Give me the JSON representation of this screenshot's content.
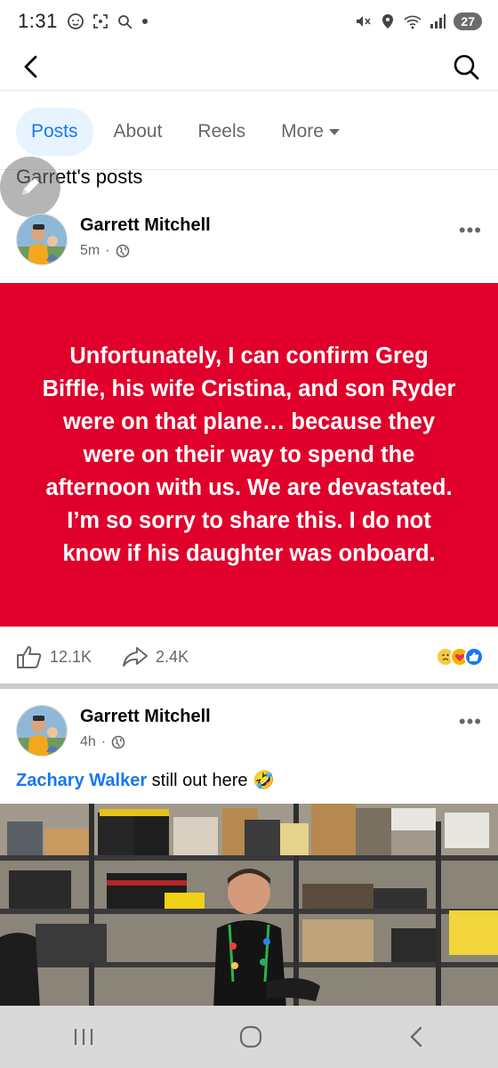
{
  "status_bar": {
    "time": "1:31",
    "battery": "27",
    "left_icons": [
      "messenger-icon",
      "screenshot-icon",
      "lens-icon",
      "dot-icon"
    ],
    "right_icons": [
      "mute-icon",
      "location-icon",
      "wifi-6-icon",
      "signal-icon"
    ]
  },
  "top_nav": {
    "back_icon": "chevron-left-icon",
    "search_icon": "search-icon"
  },
  "tabs": [
    {
      "label": "Posts",
      "active": true
    },
    {
      "label": "About",
      "active": false
    },
    {
      "label": "Reels",
      "active": false
    },
    {
      "label": "More",
      "active": false
    }
  ],
  "section_title": "Garrett's posts",
  "posts": [
    {
      "author": "Garrett Mitchell",
      "time": "5m",
      "privacy_icon": "globe-icon",
      "text": "Unfortunately, I can confirm Greg Biffle, his wife Cristina, and son Ryder were on that plane… because they were on their way to spend the afternoon with us. We are devastated. I’m so sorry to share this. I do not know if his daughter was onboard.",
      "background_color": "#e0002b",
      "likes": "12.1K",
      "shares": "2.4K",
      "reaction_icons": [
        "sad-emoji-icon",
        "care-emoji-icon",
        "like-reaction-icon"
      ]
    },
    {
      "author": "Garrett Mitchell",
      "time": "4h",
      "privacy_icon": "globe-icon",
      "mention": "Zachary Walker",
      "caption": " still out here 🤣"
    }
  ],
  "nav_bar": [
    "recents-icon",
    "home-icon",
    "back-icon"
  ],
  "colors": {
    "accent": "#1877f2",
    "secondary_text": "#65676b",
    "tab_active_bg": "#e7f3ff"
  }
}
